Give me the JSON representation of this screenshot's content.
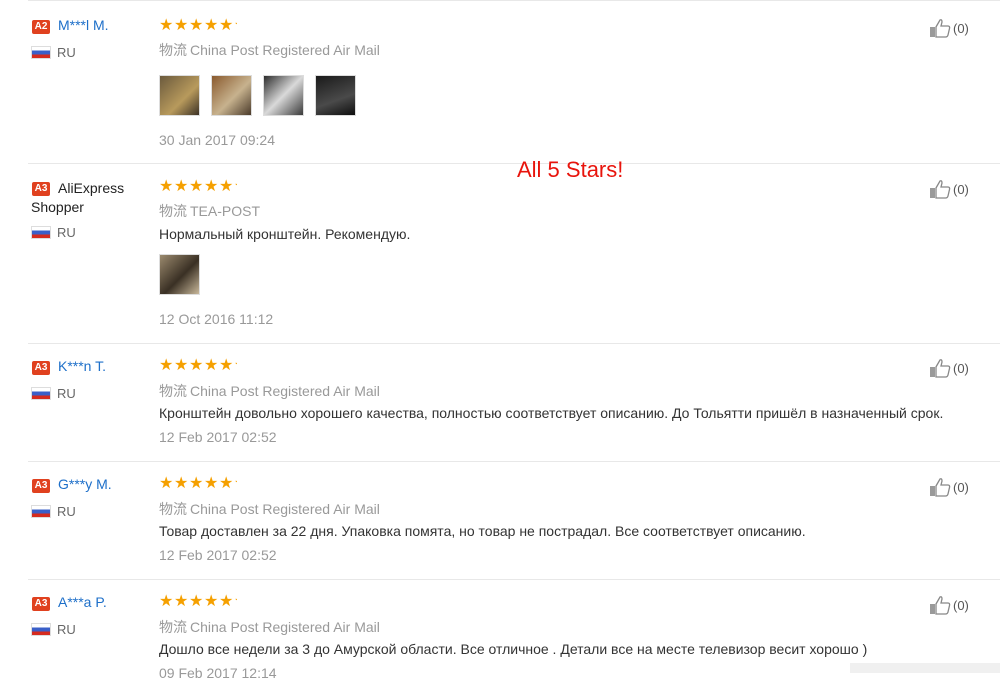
{
  "annotation": "All 5 Stars!",
  "reviews": [
    {
      "badge": "A2",
      "name": "M***l M.",
      "country": "RU",
      "shipping_prefix": "物流",
      "shipping": "China Post Registered Air Mail",
      "feedback": "",
      "date": "30 Jan 2017 09:24",
      "likes": "(0)",
      "stars": 5,
      "photo_colors": [
        "#6b5a3d",
        "#8a5a2e",
        "#2c2c2c",
        "#1a1a1a"
      ]
    },
    {
      "badge": "A3",
      "name": "AliExpress Shopper",
      "country": "RU",
      "shipping_prefix": "物流",
      "shipping": "TEA-POST",
      "feedback": "Нормальный кронштейн. Рекомендую.",
      "date": "12 Oct 2016 11:12",
      "likes": "(0)",
      "stars": 5,
      "photo_colors": [
        "#9b8a6e"
      ]
    },
    {
      "badge": "A3",
      "name": "K***n T.",
      "country": "RU",
      "shipping_prefix": "物流",
      "shipping": "China Post Registered Air Mail",
      "feedback": "Кронштейн довольно хорошего качества, полностью соответствует описанию. До Тольятти пришёл в назначенный срок.",
      "date": "12 Feb 2017 02:52",
      "likes": "(0)",
      "stars": 5,
      "photo_colors": []
    },
    {
      "badge": "A3",
      "name": "G***y M.",
      "country": "RU",
      "shipping_prefix": "物流",
      "shipping": "China Post Registered Air Mail",
      "feedback": "Товар доставлен за 22 дня. Упаковка помята, но товар не пострадал. Все соответствует описанию.",
      "date": "12 Feb 2017 02:52",
      "likes": "(0)",
      "stars": 5,
      "photo_colors": []
    },
    {
      "badge": "A3",
      "name": "A***a P.",
      "country": "RU",
      "shipping_prefix": "物流",
      "shipping": "China Post Registered Air Mail",
      "feedback": "Дошло все недели за 3 до Амурской области. Все отличное . Детали все на месте телевизор весит хорошо )",
      "date": "09 Feb 2017 12:14",
      "likes": "(0)",
      "stars": 5,
      "photo_colors": []
    }
  ]
}
